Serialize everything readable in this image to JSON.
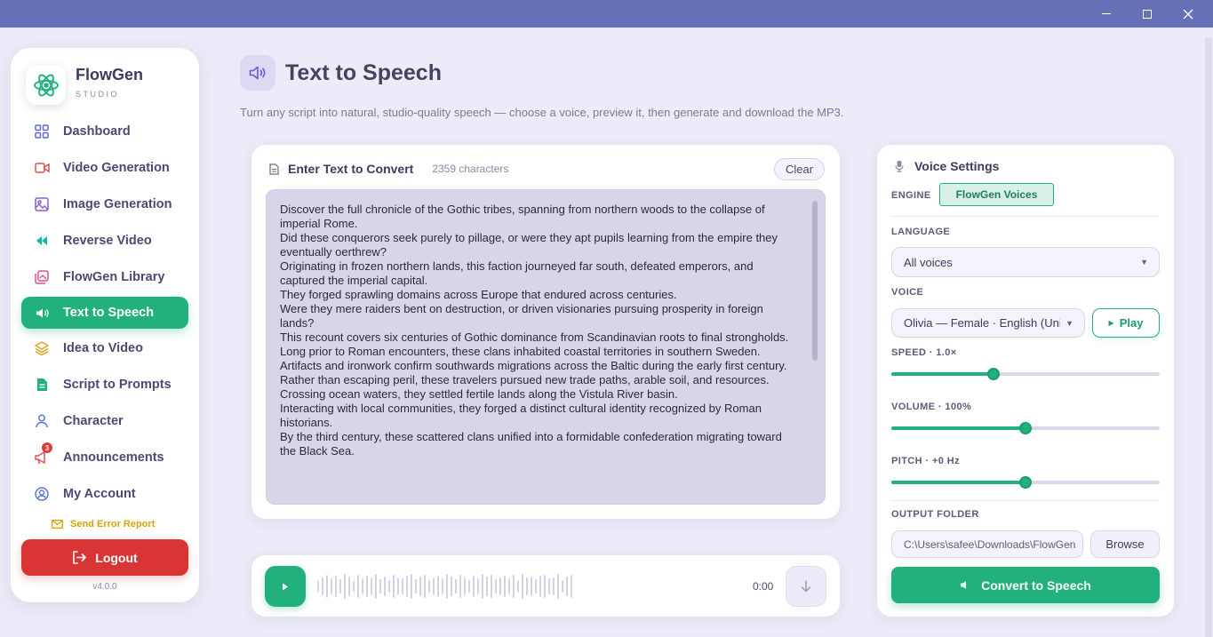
{
  "window": {
    "title": ""
  },
  "app": {
    "name": "FlowGen",
    "subtitle": "STUDIO",
    "version": "v4.0.0"
  },
  "sidebar": {
    "items": [
      {
        "label": "Dashboard",
        "icon": "grid-icon"
      },
      {
        "label": "Video Generation",
        "icon": "video-camera-icon"
      },
      {
        "label": "Image Generation",
        "icon": "image-icon"
      },
      {
        "label": "Reverse Video",
        "icon": "rewind-icon"
      },
      {
        "label": "FlowGen Library",
        "icon": "library-icon"
      },
      {
        "label": "Text to Speech",
        "icon": "speaker-icon",
        "active": true
      },
      {
        "label": "Idea to Video",
        "icon": "layers-icon"
      },
      {
        "label": "Script to Prompts",
        "icon": "document-icon"
      },
      {
        "label": "Character",
        "icon": "person-icon"
      },
      {
        "label": "Announcements",
        "icon": "megaphone-icon",
        "badge": "3"
      },
      {
        "label": "My Account",
        "icon": "account-icon"
      }
    ],
    "error_report": "Send Error Report",
    "logout": "Logout"
  },
  "header": {
    "title": "Text to Speech",
    "subtitle": "Turn any script into natural, studio-quality speech — choose a voice, preview it, then generate and download the MP3."
  },
  "editor": {
    "title": "Enter Text to Convert",
    "char_count": "2359 characters",
    "clear_label": "Clear",
    "lines": [
      "Discover the full chronicle of the Gothic tribes, spanning from northern woods to the collapse of imperial Rome.",
      "Did these conquerors seek purely to pillage, or were they apt pupils learning from the empire they eventually oerthrew?",
      "Originating in frozen northern lands, this faction journeyed far south, defeated emperors, and captured the imperial capital.",
      "They forged sprawling domains across Europe that endured across centuries.",
      "Were they mere raiders bent on destruction, or driven visionaries pursuing prosperity in foreign lands?",
      "This recount covers six centuries of Gothic dominance from Scandinavian roots to final strongholds.",
      "Long prior to Roman encounters, these clans inhabited coastal territories in southern Sweden.",
      "Artifacts and ironwork confirm southwards migrations across the Baltic during the early first century.",
      "Rather than escaping peril, these travelers pursued new trade paths, arable soil, and resources.",
      "Crossing ocean waters, they settled fertile lands along the Vistula River basin.",
      "Interacting with local communities, they forged a distinct cultural identity recognized by Roman historians.",
      "By the third century, these scattered clans unified into a formidable confederation migrating toward the Black Sea."
    ]
  },
  "player": {
    "time": "0:00"
  },
  "voice_settings": {
    "title": "Voice Settings",
    "engine_label": "ENGINE",
    "engine_value": "FlowGen Voices",
    "language_label": "LANGUAGE",
    "language_value": "All voices",
    "voice_label": "VOICE",
    "voice_value": "Olivia — Female · English (United Kingdom)",
    "play_label": "Play",
    "speed_label": "SPEED · 1.0×",
    "speed_value": 0.38,
    "volume_label": "VOLUME · 100%",
    "volume_value": 0.5,
    "pitch_label": "PITCH · +0 Hz",
    "pitch_value": 0.5,
    "output_label": "OUTPUT FOLDER",
    "output_path": "C:\\Users\\safee\\Downloads\\FlowGen",
    "browse_label": "Browse",
    "convert_label": "Convert to Speech"
  },
  "colors": {
    "accent": "#22b07d",
    "danger": "#d93535",
    "titlebar": "#6570b6",
    "warning": "#d9a400"
  }
}
